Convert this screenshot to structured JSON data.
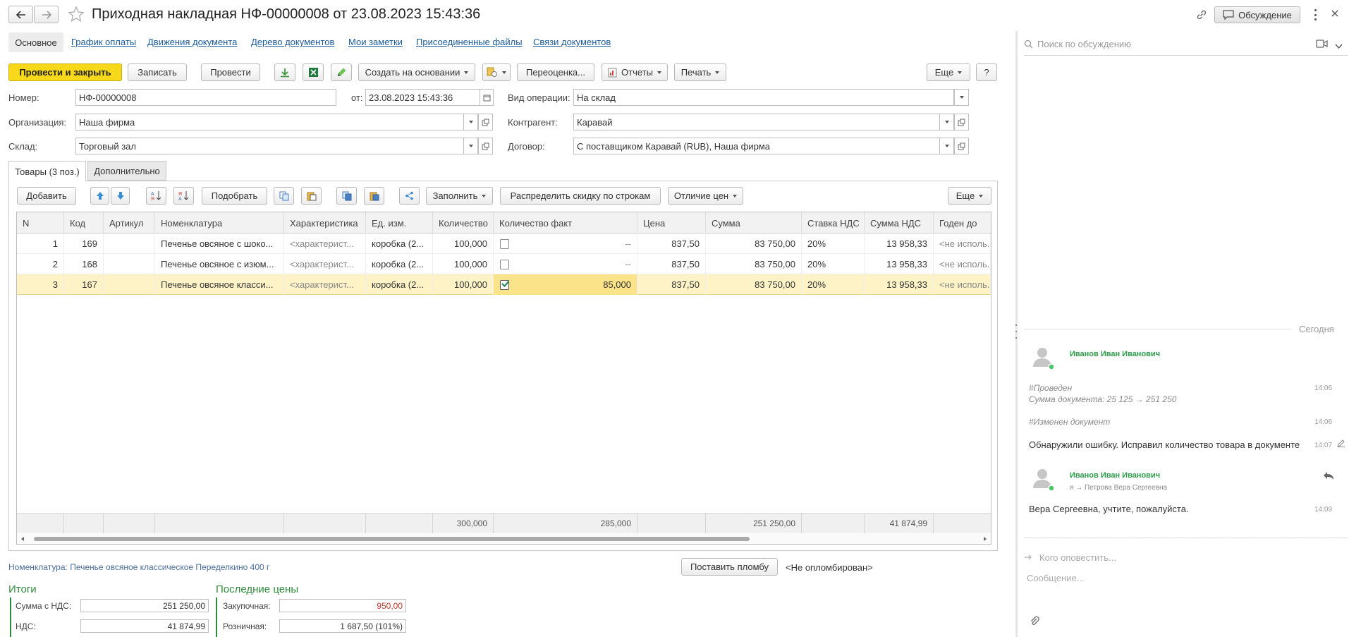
{
  "window": {
    "title": "Приходная накладная НФ-00000008 от 23.08.2023 15:43:36",
    "discussion_button": "Обсуждение"
  },
  "nav_tabs": [
    "Основное",
    "График оплаты",
    "Движения документа",
    "Дерево документов",
    "Мои заметки",
    "Присоединенные файлы",
    "Связи документов"
  ],
  "toolbar": {
    "post_close": "Провести и закрыть",
    "save": "Записать",
    "post": "Провести",
    "create_basis": "Создать на основании",
    "revaluation": "Переоценка...",
    "reports": "Отчеты",
    "print": "Печать",
    "more": "Еще",
    "help": "?"
  },
  "header_fields": {
    "number_label": "Номер:",
    "number_value": "НФ-00000008",
    "date_label": "от:",
    "date_value": "23.08.2023 15:43:36",
    "operation_label": "Вид операции:",
    "operation_value": "На склад",
    "org_label": "Организация:",
    "org_value": "Наша фирма",
    "counterparty_label": "Контрагент:",
    "counterparty_value": "Каравай",
    "warehouse_label": "Склад:",
    "warehouse_value": "Торговый зал",
    "contract_label": "Договор:",
    "contract_value": "С поставщиком Каравай (RUB), Наша фирма"
  },
  "inner_tabs": [
    "Товары (3 поз.)",
    "Дополнительно"
  ],
  "table_toolbar": {
    "add": "Добавить",
    "pick": "Подобрать",
    "fill": "Заполнить",
    "distribute": "Распределить скидку по строкам",
    "price_diff": "Отличие цен",
    "more": "Еще"
  },
  "table": {
    "headers": [
      "N",
      "Код",
      "Артикул",
      "Номенклатура",
      "Характеристика",
      "Ед. изм.",
      "Количество",
      "Количество факт",
      "Цена",
      "Сумма",
      "Ставка НДС",
      "Сумма НДС",
      "Годен до"
    ],
    "rows": [
      {
        "n": "1",
        "code": "169",
        "article": "",
        "name": "Печенье овсяное с шоко...",
        "char": "<характерист...",
        "unit": "коробка (2...",
        "qty": "100,000",
        "checked": false,
        "fact": "--",
        "price": "837,50",
        "sum": "83 750,00",
        "vat": "20%",
        "vat_sum": "13 958,33",
        "expiry": "<не исполь..."
      },
      {
        "n": "2",
        "code": "168",
        "article": "",
        "name": "Печенье овсяное с изюм...",
        "char": "<характерист...",
        "unit": "коробка (2...",
        "qty": "100,000",
        "checked": false,
        "fact": "--",
        "price": "837,50",
        "sum": "83 750,00",
        "vat": "20%",
        "vat_sum": "13 958,33",
        "expiry": "<не исполь..."
      },
      {
        "n": "3",
        "code": "167",
        "article": "",
        "name": "Печенье овсяное класси...",
        "char": "<характерист...",
        "unit": "коробка (2...",
        "qty": "100,000",
        "checked": true,
        "fact": "85,000",
        "price": "837,50",
        "sum": "83 750,00",
        "vat": "20%",
        "vat_sum": "13 958,33",
        "expiry": "<не исполь..."
      }
    ],
    "footer": {
      "qty": "300,000",
      "fact": "285,000",
      "sum": "251 250,00",
      "vat_sum": "41 874,99"
    }
  },
  "nomenclature_line": "Номенклатура: Печенье овсяное классическое Переделкино 400 г",
  "seal_button": "Поставить пломбу",
  "seal_status": "<Не опломбирован>",
  "totals": {
    "title": "Итоги",
    "sum_label": "Сумма с НДС:",
    "sum_value": "251 250,00",
    "vat_label": "НДС:",
    "vat_value": "41 874,99"
  },
  "last_prices": {
    "title": "Последние цены",
    "purchase_label": "Закупочная:",
    "purchase_value": "950,00",
    "retail_label": "Розничная:",
    "retail_value": "1 687,50 (101%)"
  },
  "discussion": {
    "search_placeholder": "Поиск по обсуждению",
    "date_divider": "Сегодня",
    "author1": "Иванов Иван Иванович",
    "msg1_tag": "#Проведен",
    "msg1_text": "Сумма документа: 25 125 → 251 250",
    "msg1_time": "14:06",
    "msg2_tag": "#Изменен документ",
    "msg2_time": "14:06",
    "msg3_text": "Обнаружили ошибку. Исправил количество товара в документе",
    "msg3_time": "14:07",
    "author2": "Иванов Иван Иванович",
    "recipient": "я → Петрова Вера Сергеевна",
    "msg4_text": "Вера Сергеевна, учтите, пожалуйста.",
    "msg4_time": "14:09",
    "notify_placeholder": "Кого оповестить...",
    "message_placeholder": "Сообщение..."
  },
  "colors": {
    "accent_yellow": "#f7d81b",
    "selected_row": "#fdf3c6",
    "selected_cell": "#fbe38a",
    "author_green": "#2e9b4a",
    "red_value": "#c0392b",
    "section_green": "#2e8b3d"
  }
}
